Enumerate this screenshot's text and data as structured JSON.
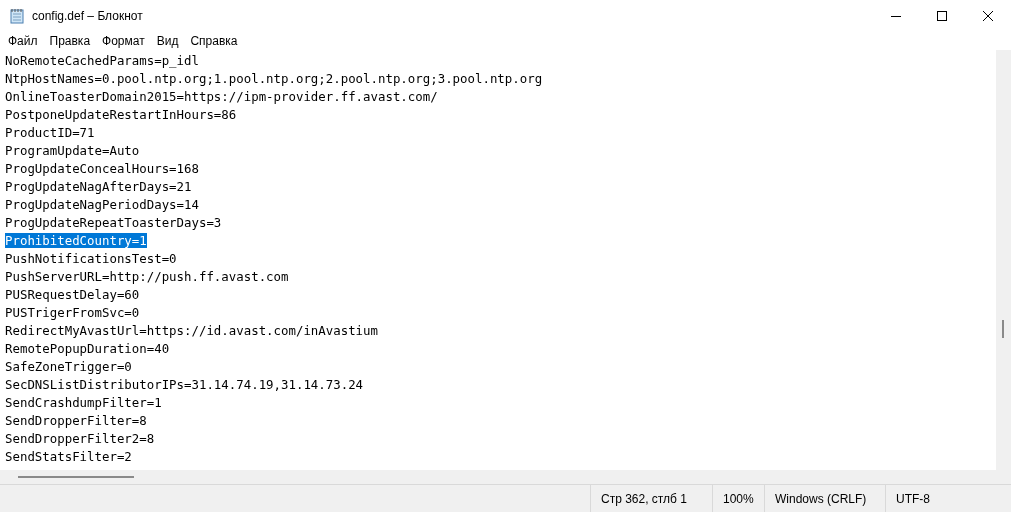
{
  "window": {
    "title": "config.def – Блокнот"
  },
  "menu": [
    "Файл",
    "Правка",
    "Формат",
    "Вид",
    "Справка"
  ],
  "lines": [
    {
      "text": "NoRemoteCachedParams=p_idl",
      "selected": false
    },
    {
      "text": "NtpHostNames=0.pool.ntp.org;1.pool.ntp.org;2.pool.ntp.org;3.pool.ntp.org",
      "selected": false
    },
    {
      "text": "OnlineToasterDomain2015=https://ipm-provider.ff.avast.com/",
      "selected": false
    },
    {
      "text": "PostponeUpdateRestartInHours=86",
      "selected": false
    },
    {
      "text": "ProductID=71",
      "selected": false
    },
    {
      "text": "ProgramUpdate=Auto",
      "selected": false
    },
    {
      "text": "ProgUpdateConcealHours=168",
      "selected": false
    },
    {
      "text": "ProgUpdateNagAfterDays=21",
      "selected": false
    },
    {
      "text": "ProgUpdateNagPeriodDays=14",
      "selected": false
    },
    {
      "text": "ProgUpdateRepeatToasterDays=3",
      "selected": false
    },
    {
      "text": "ProhibitedCountry=1",
      "selected": true
    },
    {
      "text": "PushNotificationsTest=0",
      "selected": false
    },
    {
      "text": "PushServerURL=http://push.ff.avast.com",
      "selected": false
    },
    {
      "text": "PUSRequestDelay=60",
      "selected": false
    },
    {
      "text": "PUSTrigerFromSvc=0",
      "selected": false
    },
    {
      "text": "RedirectMyAvastUrl=https://id.avast.com/inAvastium",
      "selected": false
    },
    {
      "text": "RemotePopupDuration=40",
      "selected": false
    },
    {
      "text": "SafeZoneTrigger=0",
      "selected": false
    },
    {
      "text": "SecDNSListDistributorIPs=31.14.74.19,31.14.73.24",
      "selected": false
    },
    {
      "text": "SendCrashdumpFilter=1",
      "selected": false
    },
    {
      "text": "SendDropperFilter=8",
      "selected": false
    },
    {
      "text": "SendDropperFilter2=8",
      "selected": false
    },
    {
      "text": "SendStatsFilter=2",
      "selected": false
    }
  ],
  "status_bar": [
    "Стр 362, стлб 1",
    "100%",
    "Windows (CRLF)",
    "UTF-8"
  ]
}
